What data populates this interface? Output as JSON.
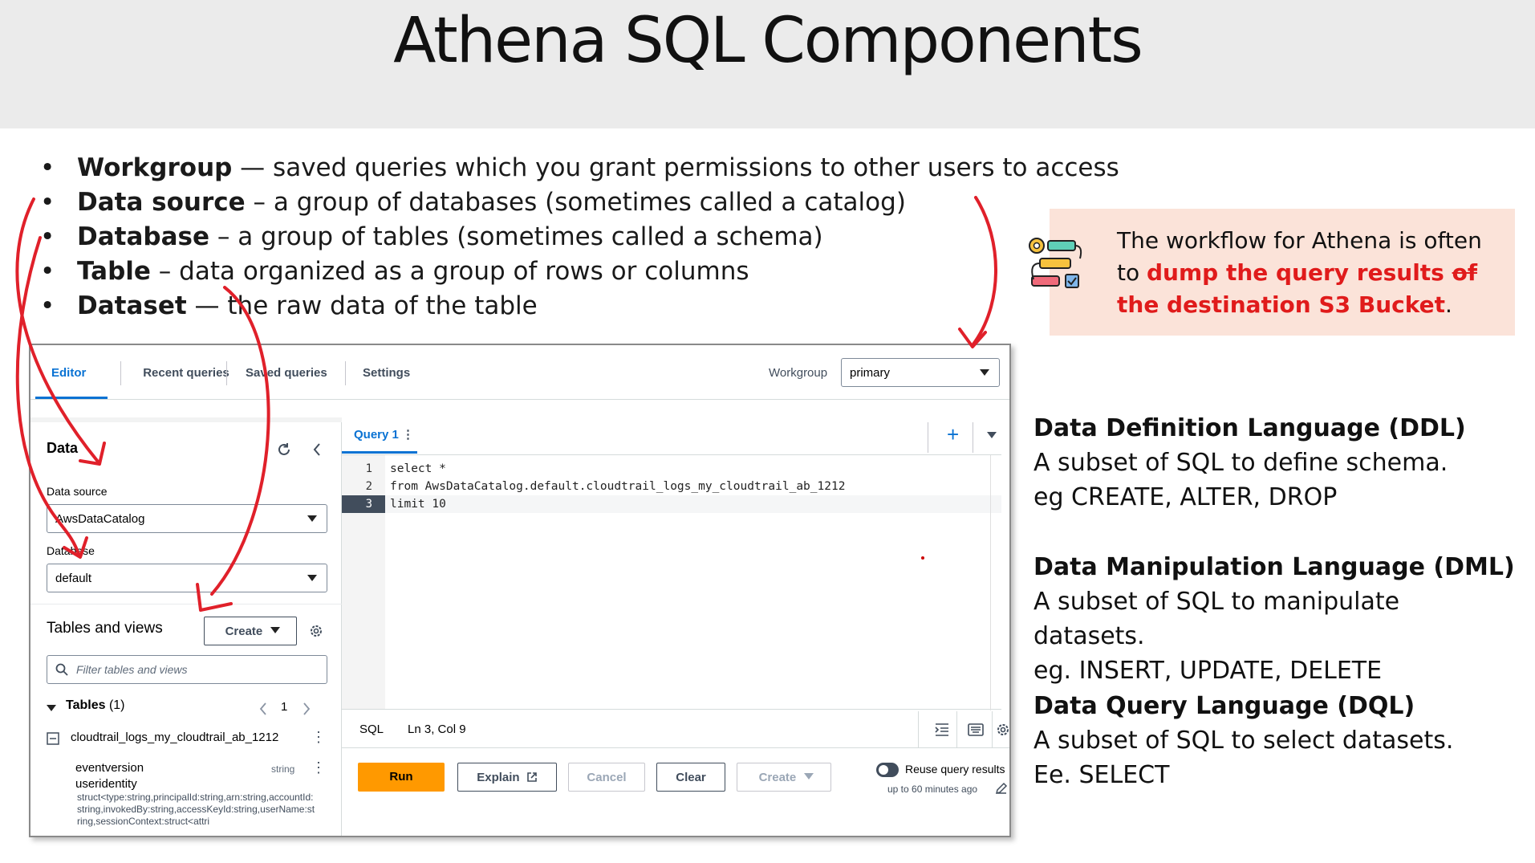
{
  "slide": {
    "title": "Athena SQL Components",
    "bullets": [
      {
        "term": "Workgroup",
        "sep": " — ",
        "desc": "saved queries which you grant permissions to other users to access"
      },
      {
        "term": "Data source",
        "sep": " – ",
        "desc": "a group of databases (sometimes called a catalog)"
      },
      {
        "term": "Database",
        "sep": " – ",
        "desc": "a group of tables (sometimes called a schema)"
      },
      {
        "term": "Table",
        "sep": " – ",
        "desc": "data organized as a group of rows or columns"
      },
      {
        "term": "Dataset",
        "sep": " — ",
        "desc": "the raw data of the table"
      }
    ],
    "bullet_glyph": "•",
    "callout": {
      "pre": "The workflow for Athena is often to ",
      "red1": "dump the query results ",
      "strike": "of",
      "red2": " the destination S3 Bucket",
      "post": "."
    },
    "languages": [
      {
        "title": "Data Definition Language (DDL)",
        "line1": "A subset of SQL to define schema.",
        "line2": "eg CREATE, ALTER, DROP"
      },
      {
        "title": "Data Manipulation Language (DML)",
        "line1": "A subset of SQL to manipulate datasets.",
        "line2": "eg. INSERT, UPDATE, DELETE"
      },
      {
        "title": "Data Query Language (DQL)",
        "line1": "A subset of SQL to select datasets.",
        "line2": "Ee. SELECT"
      }
    ],
    "colors": {
      "accent_red": "#e01b1b",
      "callout_bg": "#fbe3d9",
      "aws_blue": "#0972d3",
      "run_orange": "#ff9900",
      "arrow_red": "#e0202a"
    }
  },
  "console": {
    "tabs": [
      "Editor",
      "Recent queries",
      "Saved queries",
      "Settings"
    ],
    "workgroup_label": "Workgroup",
    "workgroup_value": "primary",
    "panel_title": "Data",
    "data_source_label": "Data source",
    "data_source_value": "AwsDataCatalog",
    "database_label": "Database",
    "database_value": "default",
    "tables_views_label": "Tables and views",
    "create_label": "Create",
    "filter_placeholder": "Filter tables and views",
    "tables_label": "Tables",
    "tables_count": "(1)",
    "page_number": "1",
    "table_name": "cloudtrail_logs_my_cloudtrail_ab_1212",
    "columns": [
      {
        "name": "eventversion",
        "type": "string"
      },
      {
        "name": "useridentity",
        "type": ""
      }
    ],
    "struct_text": "struct<type:string,principalId:string,arn:string,accountId:string,invokedBy:string,accessKeyId:string,userName:string,sessionContext:struct<attri",
    "query_tab": "Query 1",
    "code_lines": [
      {
        "n": "1",
        "text": "select *"
      },
      {
        "n": "2",
        "text": "from AwsDataCatalog.default.cloudtrail_logs_my_cloudtrail_ab_1212"
      },
      {
        "n": "3",
        "text": "limit 10"
      }
    ],
    "status_lang": "SQL",
    "status_pos": "Ln 3, Col 9",
    "buttons": {
      "run": "Run",
      "explain": "Explain",
      "cancel": "Cancel",
      "clear": "Clear",
      "create": "Create"
    },
    "reuse_label": "Reuse query results",
    "reuse_sub": "up to 60 minutes ago"
  }
}
